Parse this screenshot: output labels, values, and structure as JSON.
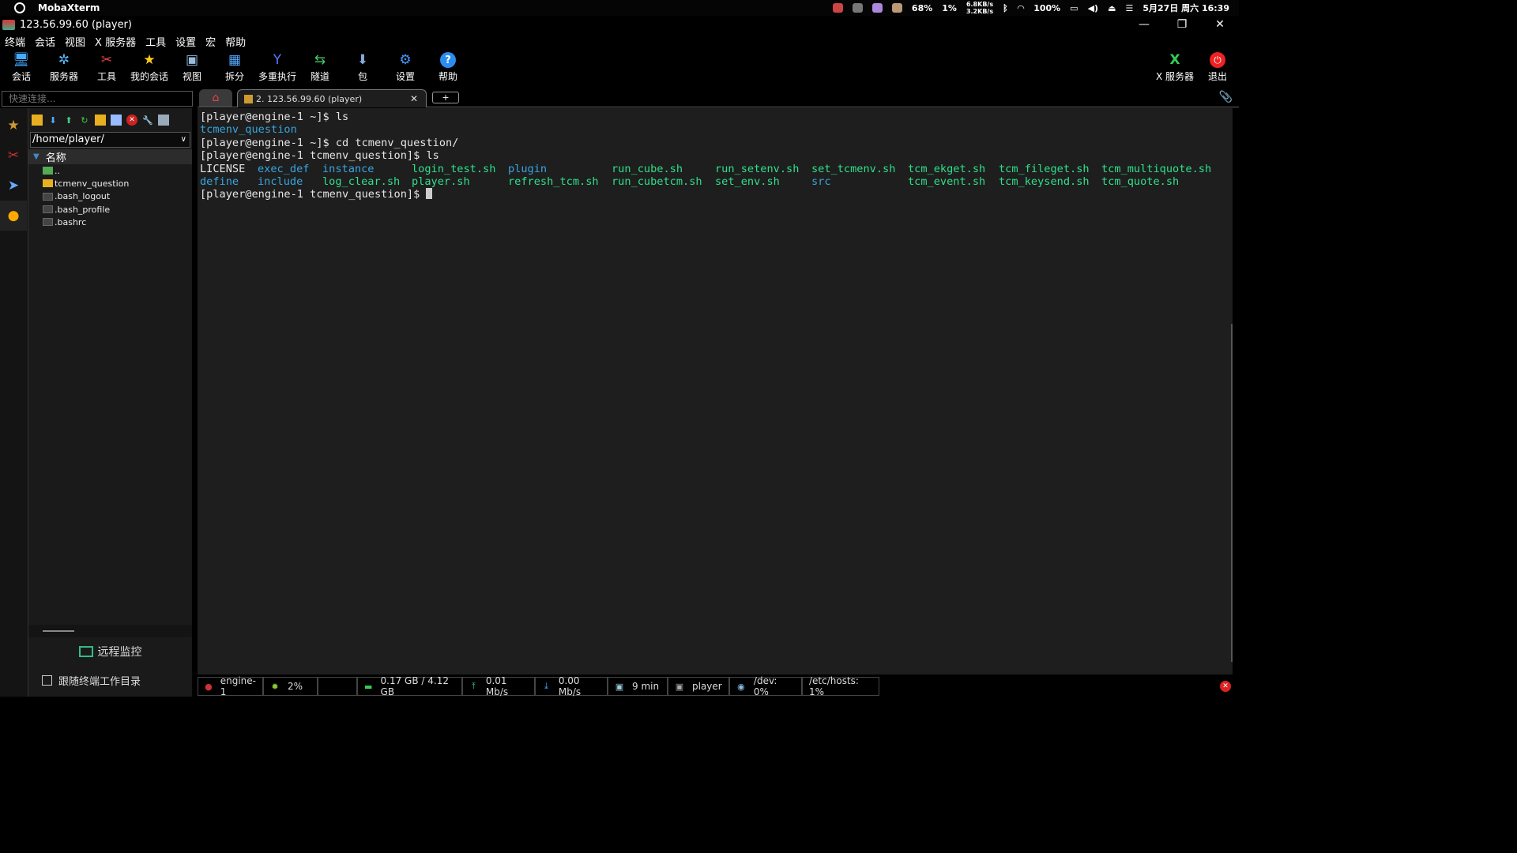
{
  "macbar": {
    "app_name": "MobaXterm",
    "cpu_temp": "68%",
    "cpu": "1%",
    "net_up": "6.8KB/s",
    "net_down": "3.2KB/s",
    "battery": "100%",
    "datetime": "5月27日 周六 16:39"
  },
  "window": {
    "title": "123.56.99.60 (player)",
    "minimize": "—",
    "restore": "❐",
    "close": "✕"
  },
  "menu": [
    "终端",
    "会话",
    "视图",
    "X 服务器",
    "工具",
    "设置",
    "宏",
    "帮助"
  ],
  "toolbar": {
    "items": [
      {
        "label": "会话",
        "icon": "session-icon"
      },
      {
        "label": "服务器",
        "icon": "servers-icon"
      },
      {
        "label": "工具",
        "icon": "tools-icon"
      },
      {
        "label": "我的会话",
        "icon": "star-icon"
      },
      {
        "label": "视图",
        "icon": "view-icon"
      },
      {
        "label": "拆分",
        "icon": "split-icon"
      },
      {
        "label": "多重执行",
        "icon": "multiexec-icon"
      },
      {
        "label": "隧道",
        "icon": "tunnel-icon"
      },
      {
        "label": "包",
        "icon": "package-icon"
      },
      {
        "label": "设置",
        "icon": "settings-icon"
      },
      {
        "label": "帮助",
        "icon": "help-icon"
      }
    ],
    "xserver": "X 服务器",
    "exit": "退出"
  },
  "quick_connect": {
    "placeholder": "快速连接..."
  },
  "tabs": {
    "session": "2. 123.56.99.60 (player)",
    "close": "✕",
    "add": "+"
  },
  "sftp": {
    "path": "/home/player/",
    "column": "名称",
    "files": [
      "..",
      "tcmenv_question",
      ".bash_logout",
      ".bash_profile",
      ".bashrc"
    ],
    "remote_monitor": "远程监控",
    "follow_terminal": "跟随终端工作目录"
  },
  "terminal": {
    "lines": [
      "[player@engine-1 ~]$ ls",
      null,
      "[player@engine-1 ~]$ cd tcmenv_question/",
      "[player@engine-1 tcmenv_question]$ ls"
    ],
    "ls1": "tcmenv_question",
    "grid": [
      [
        {
          "t": "LICENSE",
          "c": "w"
        },
        {
          "t": "exec_def",
          "c": "b"
        },
        {
          "t": "instance",
          "c": "b"
        },
        {
          "t": "login_test.sh",
          "c": "g"
        },
        {
          "t": "plugin",
          "c": "b"
        },
        {
          "t": "run_cube.sh",
          "c": "g"
        },
        {
          "t": "run_setenv.sh",
          "c": "g"
        },
        {
          "t": "set_tcmenv.sh",
          "c": "g"
        },
        {
          "t": "tcm_ekget.sh",
          "c": "g"
        },
        {
          "t": "tcm_fileget.sh",
          "c": "g"
        },
        {
          "t": "tcm_multiquote.sh",
          "c": "g"
        }
      ],
      [
        {
          "t": "define",
          "c": "b"
        },
        {
          "t": "include",
          "c": "b"
        },
        {
          "t": "log_clear.sh",
          "c": "g"
        },
        {
          "t": "player.sh",
          "c": "g"
        },
        {
          "t": "refresh_tcm.sh",
          "c": "g"
        },
        {
          "t": "run_cubetcm.sh",
          "c": "g"
        },
        {
          "t": "set_env.sh",
          "c": "g"
        },
        {
          "t": "src",
          "c": "b"
        },
        {
          "t": "tcm_event.sh",
          "c": "g"
        },
        {
          "t": "tcm_keysend.sh",
          "c": "g"
        },
        {
          "t": "tcm_quote.sh",
          "c": "g"
        }
      ]
    ],
    "prompt": "[player@engine-1 tcmenv_question]$ "
  },
  "colors": {
    "dir": "#36a6e0",
    "exec": "#2ee08a",
    "text": "#e6e6e6"
  },
  "status": {
    "host": "engine-1",
    "cpu": "2%",
    "memory": "0.17 GB / 4.12 GB",
    "upload": "0.01 Mb/s",
    "download": "0.00 Mb/s",
    "uptime": "9 min",
    "user": "player",
    "dev": "/dev: 0%",
    "hosts": "/etc/hosts: 1%"
  }
}
